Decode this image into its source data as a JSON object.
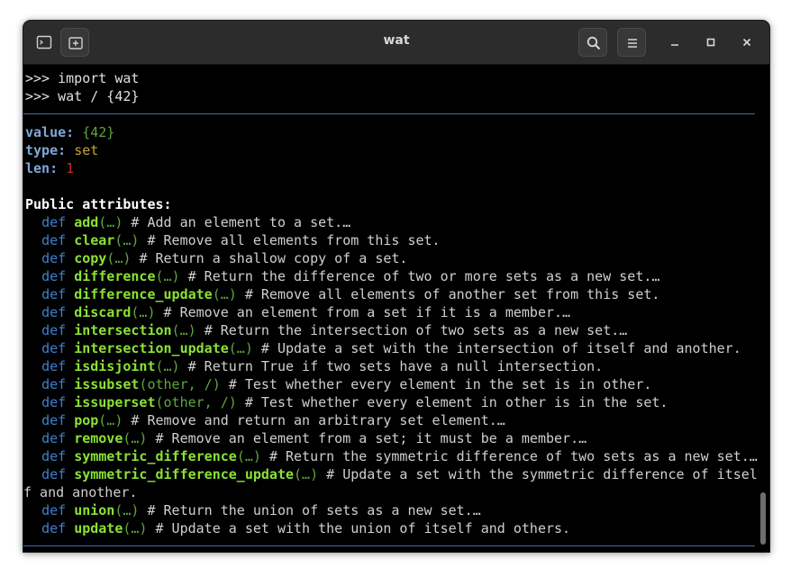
{
  "window": {
    "title": "wat"
  },
  "prompt": {
    "symbol": ">>>",
    "lines": [
      "import wat",
      "wat / {42}"
    ]
  },
  "summary": {
    "value_key": "value:",
    "value": "{42}",
    "type_key": "type:",
    "type": "set",
    "len_key": "len:",
    "len": "1"
  },
  "public_header": "Public attributes:",
  "methods": [
    {
      "name": "add",
      "sig": "(…)",
      "comment": "# Add an element to a set.…"
    },
    {
      "name": "clear",
      "sig": "(…)",
      "comment": "# Remove all elements from this set."
    },
    {
      "name": "copy",
      "sig": "(…)",
      "comment": "# Return a shallow copy of a set."
    },
    {
      "name": "difference",
      "sig": "(…)",
      "comment": "# Return the difference of two or more sets as a new set.…"
    },
    {
      "name": "difference_update",
      "sig": "(…)",
      "comment": "# Remove all elements of another set from this set."
    },
    {
      "name": "discard",
      "sig": "(…)",
      "comment": "# Remove an element from a set if it is a member.…"
    },
    {
      "name": "intersection",
      "sig": "(…)",
      "comment": "# Return the intersection of two sets as a new set.…"
    },
    {
      "name": "intersection_update",
      "sig": "(…)",
      "comment": "# Update a set with the intersection of itself and another."
    },
    {
      "name": "isdisjoint",
      "sig": "(…)",
      "comment": "# Return True if two sets have a null intersection."
    },
    {
      "name": "issubset",
      "sig": "(other, /)",
      "comment": "# Test whether every element in the set is in other."
    },
    {
      "name": "issuperset",
      "sig": "(other, /)",
      "comment": "# Test whether every element in other is in the set."
    },
    {
      "name": "pop",
      "sig": "(…)",
      "comment": "# Remove and return an arbitrary set element.…"
    },
    {
      "name": "remove",
      "sig": "(…)",
      "comment": "# Remove an element from a set; it must be a member.…"
    },
    {
      "name": "symmetric_difference",
      "sig": "(…)",
      "comment": "# Return the symmetric difference of two sets as a new set.…"
    },
    {
      "name": "symmetric_difference_update",
      "sig": "(…)",
      "comment": "# Update a set with the symmetric difference of itsel",
      "wrap": "f and another."
    },
    {
      "name": "union",
      "sig": "(…)",
      "comment": "# Return the union of sets as a new set.…"
    },
    {
      "name": "update",
      "sig": "(…)",
      "comment": "# Update a set with the union of itself and others."
    }
  ],
  "def_keyword": "def",
  "icons": {
    "terminal": "terminal-icon",
    "new_tab": "new-tab-icon",
    "search": "search-icon",
    "menu": "hamburger-menu-icon",
    "minimize": "minimize-icon",
    "maximize": "maximize-icon",
    "close": "close-icon"
  }
}
